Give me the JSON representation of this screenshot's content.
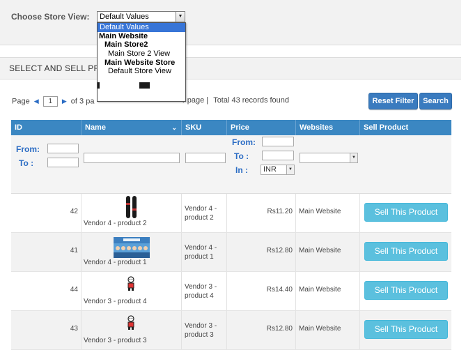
{
  "store_view": {
    "label": "Choose Store View:",
    "selected": "Default Values",
    "options": [
      {
        "label": "Default Values",
        "kind": "selected"
      },
      {
        "label": "Main Website",
        "kind": "group"
      },
      {
        "label": "Main Store2",
        "kind": "sub"
      },
      {
        "label": "Main Store 2 View",
        "kind": "opt"
      },
      {
        "label": "Main Website Store",
        "kind": "sub"
      },
      {
        "label": "Default Store View",
        "kind": "opt"
      }
    ]
  },
  "section": {
    "title": "SELECT AND SELL PR"
  },
  "pager": {
    "page_label": "Page",
    "page_value": "1",
    "of_pages": "of 3 pa",
    "per_page": "r page",
    "separator": "|",
    "total": "Total 43 records found"
  },
  "buttons": {
    "reset_filter": "Reset Filter",
    "search": "Search"
  },
  "columns": {
    "id": "ID",
    "name": "Name",
    "sku": "SKU",
    "price": "Price",
    "websites": "Websites",
    "sell": "Sell Product"
  },
  "filters": {
    "from": "From:",
    "to": "To :",
    "price_from": "From:",
    "price_to": "To :",
    "price_in": "In :",
    "currency": "INR"
  },
  "rows": [
    {
      "id": "42",
      "name": "Vendor 4 - product 2",
      "sku": "Vendor 4 - product 2",
      "price": "Rs11.20",
      "website": "Main Website",
      "action": "Sell This Product",
      "thumb": "skis"
    },
    {
      "id": "41",
      "name": "Vendor 4 - product 1",
      "sku": "Vendor 4 - product 1",
      "price": "Rs12.80",
      "website": "Main Website",
      "action": "Sell This Product",
      "thumb": "team-photo"
    },
    {
      "id": "44",
      "name": "Vendor 3 - product 4",
      "sku": "Vendor 3 - product 4",
      "price": "Rs14.40",
      "website": "Main Website",
      "action": "Sell This Product",
      "thumb": "figurine"
    },
    {
      "id": "43",
      "name": "Vendor 3 - product 3",
      "sku": "Vendor 3 - product 3",
      "price": "Rs12.80",
      "website": "Main Website",
      "action": "Sell This Product",
      "thumb": "figurine"
    }
  ],
  "colors": {
    "header_blue": "#3b87c2",
    "button_blue": "#3a7bbf",
    "sell_button": "#5bc0de",
    "link_blue": "#2b6cc4"
  }
}
